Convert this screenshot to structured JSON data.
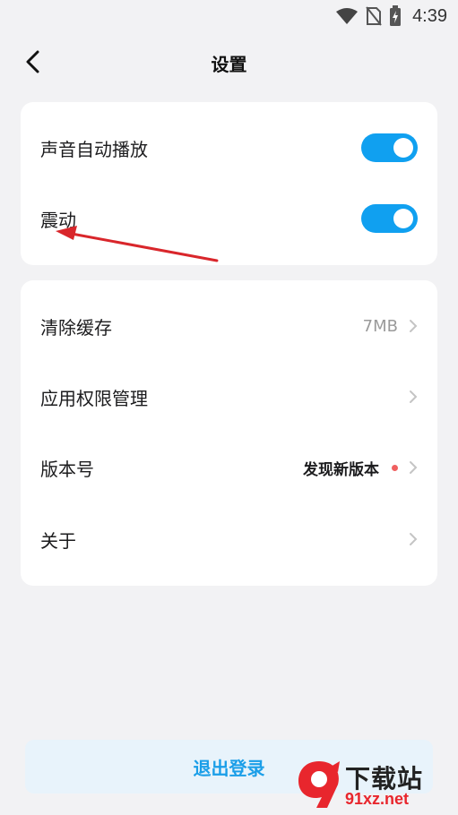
{
  "status_bar": {
    "time": "4:39",
    "icons": [
      "wifi-icon",
      "no-sim-icon",
      "battery-charging-icon"
    ]
  },
  "nav": {
    "title": "设置",
    "back_icon": "chevron-left-icon"
  },
  "settings_group1": [
    {
      "label": "声音自动播放",
      "toggle": true
    },
    {
      "label": "震动",
      "toggle": true
    }
  ],
  "settings_group2": [
    {
      "label": "清除缓存",
      "value": "7MB"
    },
    {
      "label": "应用权限管理",
      "value": ""
    },
    {
      "label": "版本号",
      "value": "发现新版本",
      "badge": "red-dot"
    },
    {
      "label": "关于",
      "value": ""
    }
  ],
  "logout_label": "退出登录",
  "colors": {
    "accent": "#10a0f0",
    "logout_bg": "#e8f3fb",
    "badge": "#f06060",
    "annotation_arrow": "#d9262b"
  },
  "watermark": {
    "text_top": "下载站",
    "text_bottom": "91xz.net"
  }
}
